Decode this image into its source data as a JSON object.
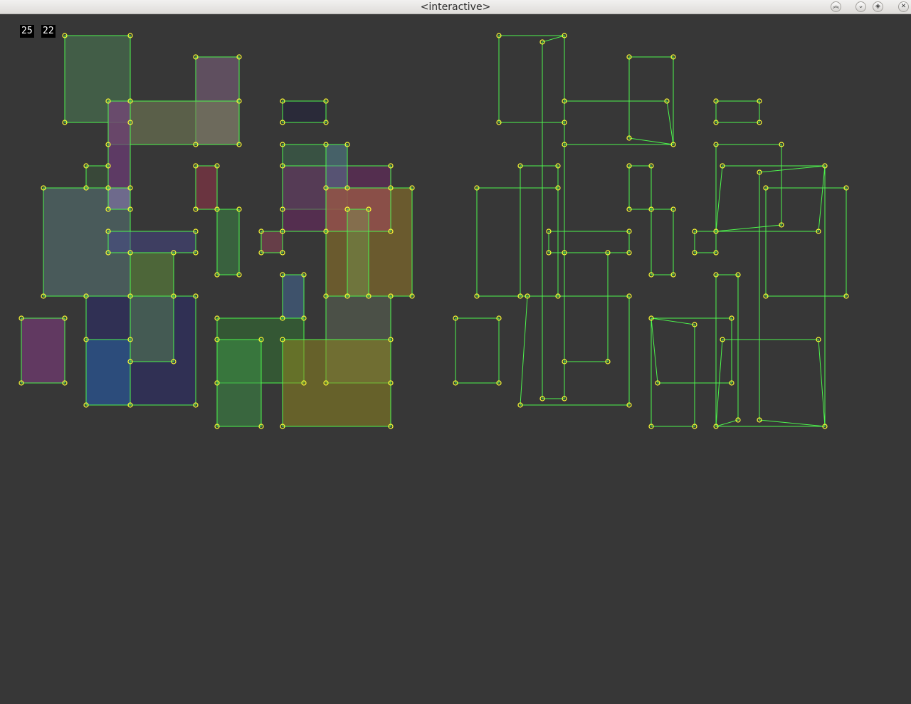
{
  "window": {
    "title": "<interactive>",
    "buttons": [
      {
        "name": "maximize-button",
        "glyph": "︽"
      },
      {
        "name": "minimize-button",
        "glyph": "⌄"
      },
      {
        "name": "restore-button",
        "glyph": "◈"
      },
      {
        "name": "close-button",
        "glyph": "✕"
      }
    ]
  },
  "counters": {
    "left": "25",
    "right": "22"
  },
  "colors": {
    "background": "#373737",
    "outline": "#4df54d",
    "vertex": "#ffff33"
  }
}
